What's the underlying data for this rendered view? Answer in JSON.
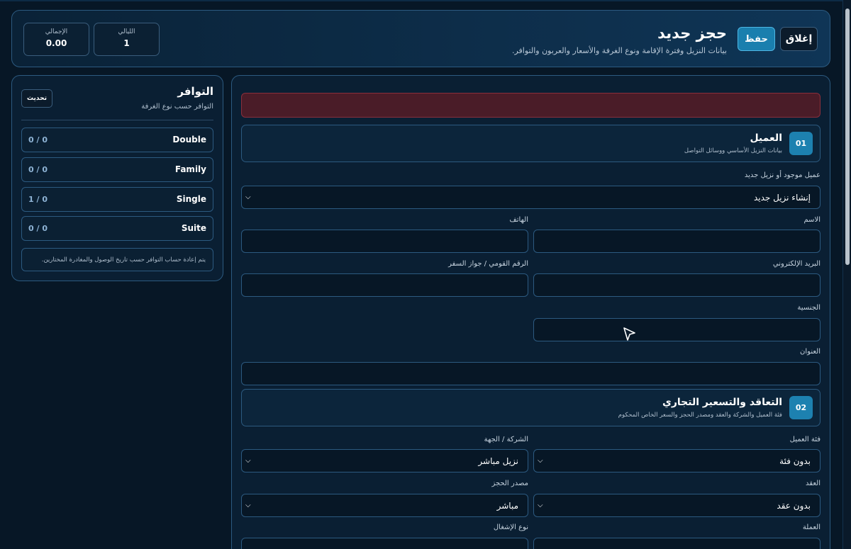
{
  "header": {
    "title": "حجز جديد",
    "subtitle": "بيانات النزيل وفترة الإقامة ونوع الغرفة والأسعار والعربون والتوافر.",
    "close_label": "إغلاق",
    "save_label": "حفظ",
    "stats": [
      {
        "label": "الليالي",
        "value": "1"
      },
      {
        "label": "الإجمالي",
        "value": "0.00"
      }
    ]
  },
  "availability": {
    "title": "التوافر",
    "subtitle": "التوافر حسب نوع الغرفة",
    "refresh_label": "تحديث",
    "rooms": [
      {
        "name": "Double",
        "count": "0 / 0"
      },
      {
        "name": "Family",
        "count": "0 / 0"
      },
      {
        "name": "Single",
        "count": "1 / 0"
      },
      {
        "name": "Suite",
        "count": "0 / 0"
      }
    ],
    "note": "يتم إعادة حساب التوافر حسب تاريخ الوصول والمغادرة المختارين."
  },
  "section_client": {
    "number": "01",
    "title": "العميل",
    "subtitle": "بيانات النزيل الأساسي ووسائل التواصل",
    "guest_select_label": "عميل موجود أو نزيل جديد",
    "guest_select_value": "إنشاء نزيل جديد",
    "name_label": "الاسم",
    "phone_label": "الهاتف",
    "email_label": "البريد الإلكتروني",
    "national_id_label": "الرقم القومي / جواز السفر",
    "nationality_label": "الجنسية",
    "address_label": "العنوان"
  },
  "section_contract": {
    "number": "02",
    "title": "التعاقد والتسعير التجاري",
    "subtitle": "فئة العميل والشركة والعقد ومصدر الحجز والسعر الخاص المحكوم",
    "client_category_label": "فئة العميل",
    "client_category_value": "بدون فئة",
    "company_label": "الشركة / الجهة",
    "company_value": "نزيل مباشر",
    "contract_label": "العقد",
    "contract_value": "بدون عقد",
    "booking_source_label": "مصدر الحجز",
    "booking_source_value": "مباشر",
    "currency_label": "العملة",
    "occupancy_label": "نوع الإشغال"
  },
  "colors": {
    "accent": "#1d81b0",
    "alert": "#4a1c28",
    "background": "#071726"
  }
}
